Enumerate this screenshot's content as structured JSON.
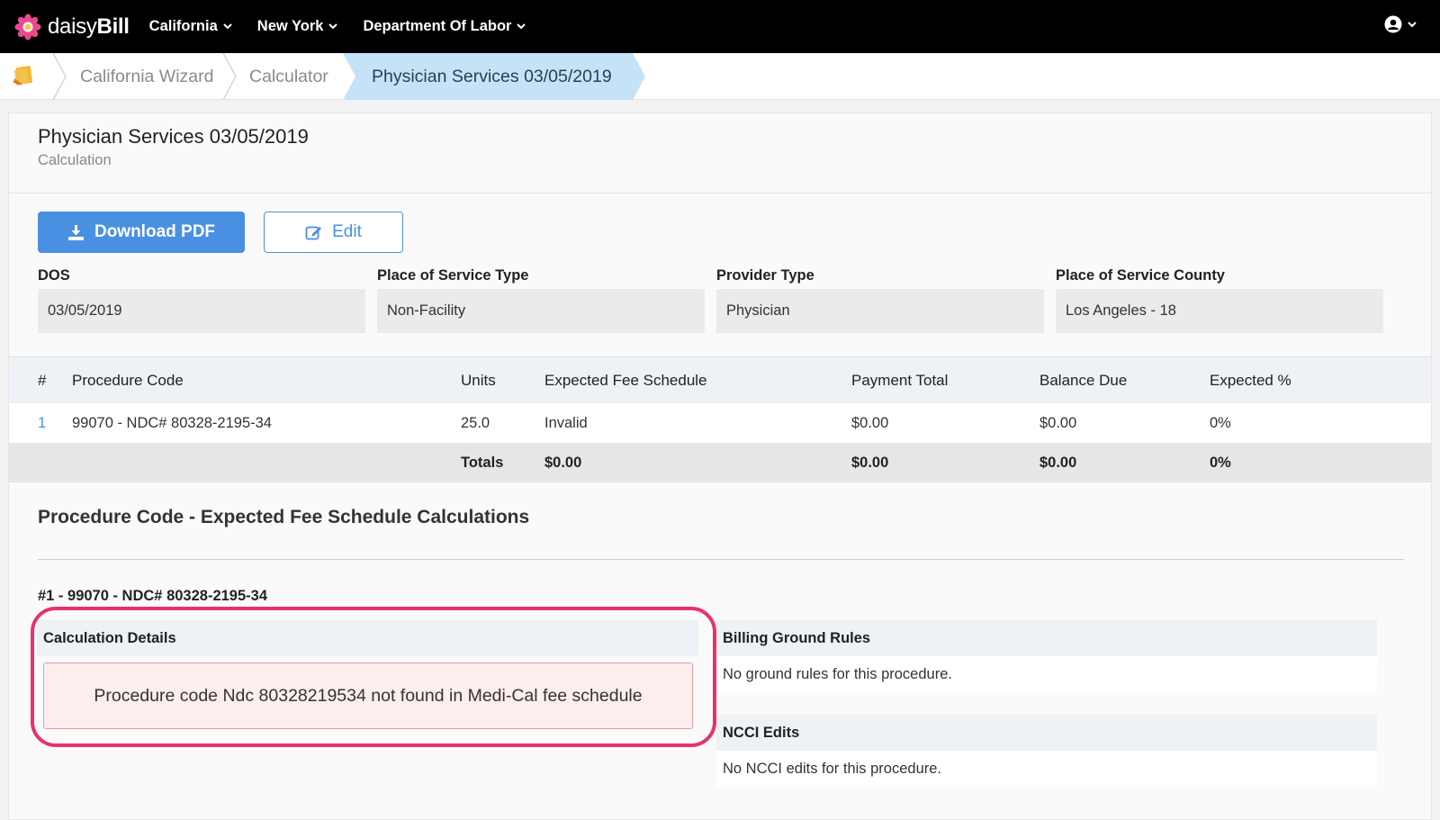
{
  "nav": {
    "brand_light": "daisy",
    "brand_bold": "Bill",
    "items": [
      {
        "label": "California"
      },
      {
        "label": "New York"
      },
      {
        "label": "Department Of Labor"
      }
    ]
  },
  "breadcrumb": {
    "items": [
      "California Wizard",
      "Calculator"
    ],
    "active": "Physician Services 03/05/2019"
  },
  "page": {
    "title": "Physician Services 03/05/2019",
    "subtitle": "Calculation"
  },
  "actions": {
    "download": "Download PDF",
    "edit": "Edit"
  },
  "fields": [
    {
      "label": "DOS",
      "value": "03/05/2019"
    },
    {
      "label": "Place of Service Type",
      "value": "Non-Facility"
    },
    {
      "label": "Provider Type",
      "value": "Physician"
    },
    {
      "label": "Place of Service County",
      "value": "Los Angeles - 18"
    }
  ],
  "table": {
    "headers": [
      "#",
      "Procedure Code",
      "Units",
      "Expected Fee Schedule",
      "Payment Total",
      "Balance Due",
      "Expected %"
    ],
    "rows": [
      [
        "1",
        "99070 - NDC# 80328-2195-34",
        "25.0",
        "Invalid",
        "$0.00",
        "$0.00",
        "0%"
      ]
    ],
    "totals": [
      "Totals",
      "$0.00",
      "$0.00",
      "$0.00",
      "0%"
    ]
  },
  "calc_section": {
    "title": "Procedure Code - Expected Fee Schedule Calculations",
    "procedure_heading": "#1 - 99070 - NDC# 80328-2195-34",
    "details_title": "Calculation Details",
    "error_message": "Procedure code Ndc 80328219534 not found in Medi-Cal fee schedule",
    "ground_rules_title": "Billing Ground Rules",
    "ground_rules_text": "No ground rules for this procedure.",
    "ncci_title": "NCCI Edits",
    "ncci_text": "No NCCI edits for this procedure."
  },
  "colors": {
    "nav_bg": "#000000",
    "accent_blue": "#4a90e2",
    "active_crumb": "#c6e2f7",
    "highlight_ring": "#e6336e",
    "error_bg": "#fdeeee"
  },
  "icons": [
    "daisy-logo-icon",
    "chevron-down-icon",
    "user-circle-icon",
    "notebook-icon",
    "download-icon",
    "edit-icon"
  ]
}
